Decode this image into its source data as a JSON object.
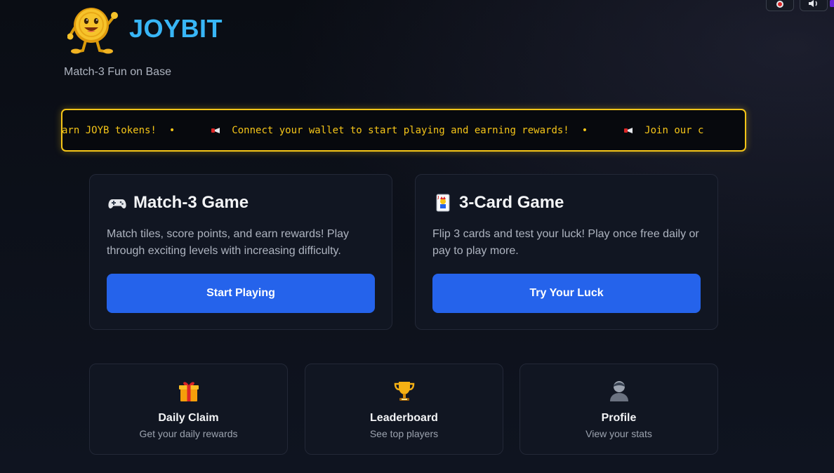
{
  "header": {
    "brand": "JOYBIT",
    "tagline": "Match-3 Fun on Base",
    "logo_icon": "smiling-coin-mascot-icon"
  },
  "top_controls": {
    "left_icon": "record-icon",
    "right_icon": "speaker-icon"
  },
  "announcement": {
    "items": [
      "arn JOYB tokens!",
      "Connect your wallet to start playing and earning rewards!",
      "Join our c"
    ],
    "separator": "•",
    "icon": "megaphone-icon",
    "color": "#f5c518"
  },
  "games": [
    {
      "icon": "game-controller-icon",
      "title": "Match-3 Game",
      "description": "Match tiles, score points, and earn rewards! Play through exciting levels with increasing difficulty.",
      "button": "Start Playing"
    },
    {
      "icon": "joker-card-icon",
      "title": "3-Card Game",
      "description": "Flip 3 cards and test your luck! Play once free daily or pay to play more.",
      "button": "Try Your Luck"
    }
  ],
  "features": [
    {
      "icon": "gift-icon",
      "label": "Daily Claim",
      "sub": "Get your daily rewards"
    },
    {
      "icon": "trophy-icon",
      "label": "Leaderboard",
      "sub": "See top players"
    },
    {
      "icon": "user-silhouette-icon",
      "label": "Profile",
      "sub": "View your stats"
    }
  ],
  "colors": {
    "accent_blue": "#2563eb",
    "brand_blue": "#38b6f6",
    "banner_gold": "#f5c518",
    "background": "#0b0f18"
  }
}
